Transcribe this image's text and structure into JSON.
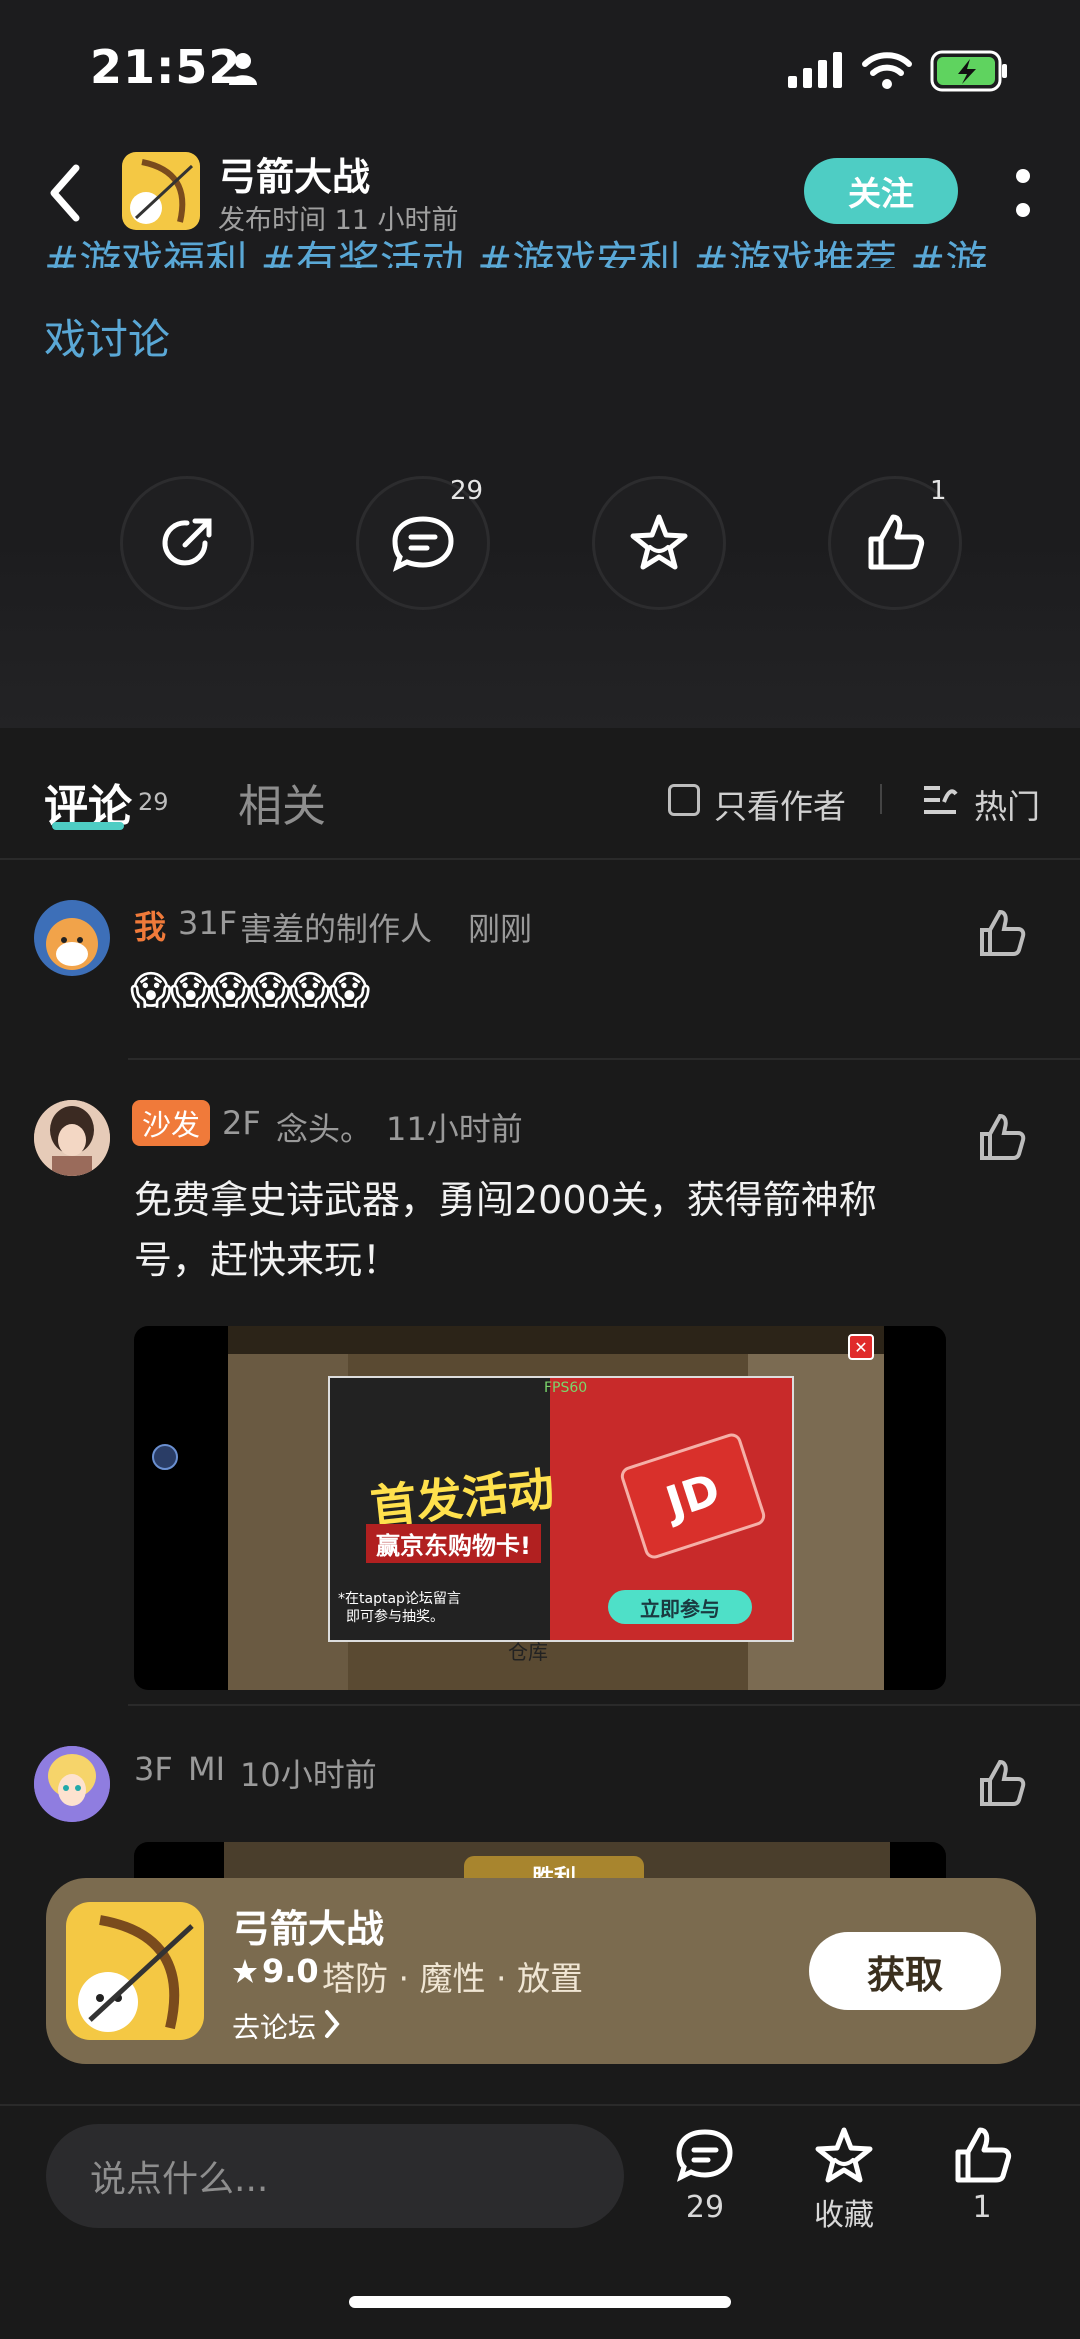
{
  "status_bar": {
    "time": "21:52"
  },
  "header": {
    "app_name": "弓箭大战",
    "publish_time": "发布时间 11 小时前",
    "follow_label": "关注"
  },
  "post": {
    "tags_line1": "#游戏福利 #有奖活动 #游戏安利 #游戏推荐 #游",
    "tags_line2": "戏讨论"
  },
  "actions": {
    "comment_count": "29",
    "like_count": "1"
  },
  "tabs": {
    "comments_label": "评论",
    "comments_count": "29",
    "related_label": "相关",
    "author_only_label": "只看作者",
    "sort_label": "热门"
  },
  "comments": [
    {
      "me_tag": "我",
      "floor": "31F",
      "user": "害羞的制作人",
      "time": "刚刚",
      "emojis": "😱😱😱😱😱😱"
    },
    {
      "sofa_tag": "沙发",
      "floor": "2F",
      "user": "念头。",
      "time": "11小时前",
      "text_line1": "免费拿史诗武器，勇闯2000关，获得箭神称",
      "text_line2": "号，赶快来玩！",
      "image": {
        "promo_title": "首发活动",
        "promo_subtitle": "赢京东购物卡!",
        "promo_note1": "*在taptap论坛留言",
        "promo_note2": "即可参与抽奖。",
        "promo_button": "立即参与",
        "fps": "FPS60",
        "warehouse": "仓库"
      }
    },
    {
      "floor": "3F",
      "user": "MI",
      "time": "10小时前",
      "image_label": "胜利"
    }
  ],
  "banner": {
    "name": "弓箭大战",
    "rating": "9.0",
    "genres": "塔防 · 魔性 · 放置",
    "forum_link": "去论坛",
    "get_label": "获取"
  },
  "bottom_bar": {
    "input_placeholder": "说点什么...",
    "comment_count": "29",
    "favorite_label": "收藏",
    "like_count": "1"
  },
  "colors": {
    "accent_teal": "#4ecdc4",
    "me_orange": "#f07a3a",
    "banner_bg": "#7b6b4f"
  }
}
